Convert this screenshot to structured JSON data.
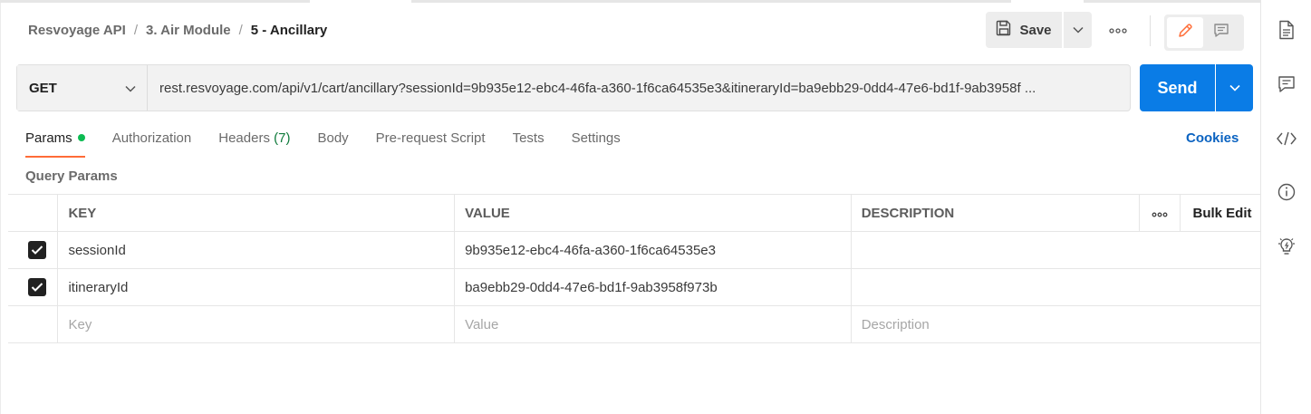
{
  "breadcrumb": {
    "items": [
      "Resvoyage API",
      "3. Air Module"
    ],
    "current": "5 - Ancillary",
    "separator": "/"
  },
  "toolbar": {
    "save_label": "Save"
  },
  "request": {
    "method": "GET",
    "url": "rest.resvoyage.com/api/v1/cart/ancillary?sessionId=9b935e12-ebc4-46fa-a360-1f6ca64535e3&itineraryId=ba9ebb29-0dd4-47e6-bd1f-9ab3958f ...",
    "send_label": "Send"
  },
  "tabs": {
    "params": "Params",
    "authorization": "Authorization",
    "headers": "Headers",
    "headers_count": "(7)",
    "body": "Body",
    "prerequest": "Pre-request Script",
    "tests": "Tests",
    "settings": "Settings",
    "cookies": "Cookies"
  },
  "params": {
    "section_title": "Query Params",
    "headers": {
      "key": "KEY",
      "value": "VALUE",
      "description": "DESCRIPTION",
      "bulk_edit": "Bulk Edit"
    },
    "rows": [
      {
        "checked": true,
        "key": "sessionId",
        "value": "9b935e12-ebc4-46fa-a360-1f6ca64535e3",
        "description": ""
      },
      {
        "checked": true,
        "key": "itineraryId",
        "value": "ba9ebb29-0dd4-47e6-bd1f-9ab3958f973b",
        "description": ""
      }
    ],
    "placeholders": {
      "key": "Key",
      "value": "Value",
      "description": "Description"
    }
  },
  "colors": {
    "accent": "#ff6c37",
    "send": "#0a7ce6",
    "status_dot": "#0cbb52",
    "link": "#0b63c1"
  },
  "icons": {
    "save": "save-icon",
    "chevron": "chevron-down-icon",
    "more": "more-horizontal-icon",
    "edit": "pencil-icon",
    "comment": "comment-icon",
    "rightbar": [
      "document-icon",
      "comment-icon",
      "code-icon",
      "info-icon",
      "lightbulb-icon"
    ]
  }
}
